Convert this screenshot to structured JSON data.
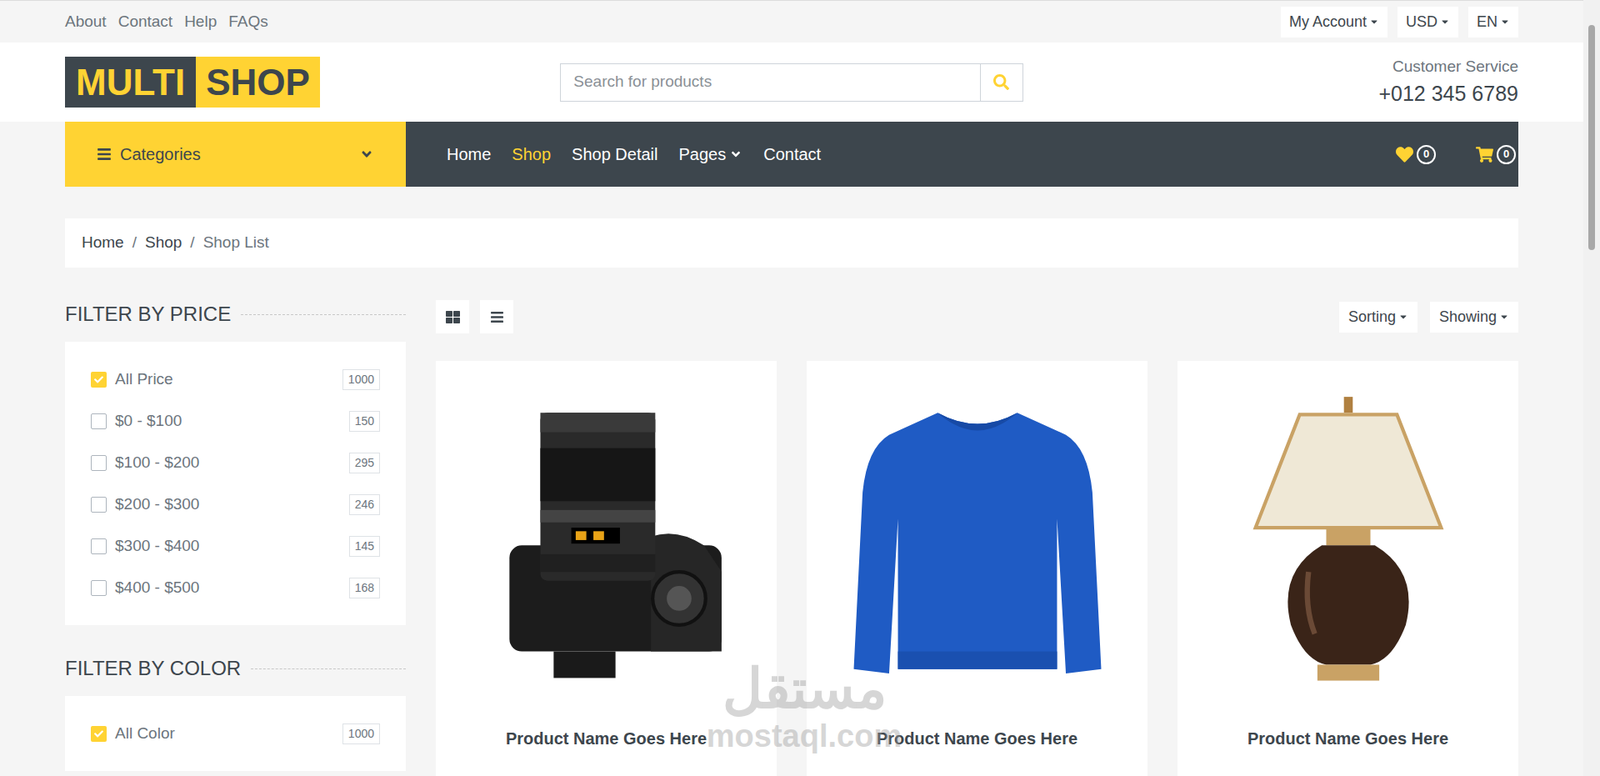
{
  "top_bar": {
    "links": [
      "About",
      "Contact",
      "Help",
      "FAQs"
    ],
    "dropdowns": [
      "My Account",
      "USD",
      "EN"
    ]
  },
  "logo": {
    "left": "MULTI",
    "right": "SHOP"
  },
  "search": {
    "placeholder": "Search for products"
  },
  "customer_service": {
    "label": "Customer Service",
    "phone": "+012 345 6789"
  },
  "nav": {
    "categories": "Categories",
    "links": [
      {
        "label": "Home",
        "selected": false,
        "dropdown": false
      },
      {
        "label": "Shop",
        "selected": true,
        "dropdown": false
      },
      {
        "label": "Shop Detail",
        "selected": false,
        "dropdown": false
      },
      {
        "label": "Pages",
        "selected": false,
        "dropdown": true
      },
      {
        "label": "Contact",
        "selected": false,
        "dropdown": false
      }
    ],
    "wishlist_count": "0",
    "cart_count": "0"
  },
  "breadcrumb": [
    {
      "label": "Home",
      "current": false
    },
    {
      "label": "Shop",
      "current": false
    },
    {
      "label": "Shop List",
      "current": true
    }
  ],
  "breadcrumb_separator": "/",
  "filters": [
    {
      "title": "FILTER BY PRICE",
      "options": [
        {
          "label": "All Price",
          "count": "1000",
          "checked": true
        },
        {
          "label": "$0 - $100",
          "count": "150",
          "checked": false
        },
        {
          "label": "$100 - $200",
          "count": "295",
          "checked": false
        },
        {
          "label": "$200 - $300",
          "count": "246",
          "checked": false
        },
        {
          "label": "$300 - $400",
          "count": "145",
          "checked": false
        },
        {
          "label": "$400 - $500",
          "count": "168",
          "checked": false
        }
      ]
    },
    {
      "title": "FILTER BY COLOR",
      "options": [
        {
          "label": "All Color",
          "count": "1000",
          "checked": true
        }
      ]
    }
  ],
  "toolbar": {
    "views": [
      {
        "kind": "grid"
      },
      {
        "kind": "list"
      }
    ],
    "dropdowns": [
      "Sorting",
      "Showing"
    ]
  },
  "products": [
    {
      "name": "Product Name Goes Here",
      "kind": "camera"
    },
    {
      "name": "Product Name Goes Here",
      "kind": "sweater"
    },
    {
      "name": "Product Name Goes Here",
      "kind": "lamp"
    }
  ],
  "watermark": {
    "arabic": "مستقل",
    "latin": "mostaql.com"
  }
}
